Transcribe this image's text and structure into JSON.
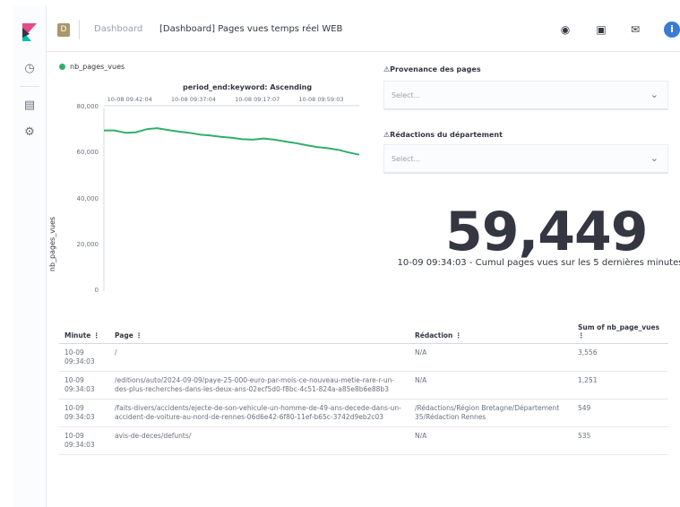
{
  "header": {
    "breadcrumb_root": "Dashboard",
    "breadcrumb_current": "[Dashboard] Pages vues temps réel WEB",
    "logo_glyph": "D"
  },
  "nav": {
    "icons": [
      "clock-icon",
      "dashboard-icon",
      "gear-icon"
    ]
  },
  "chart": {
    "legend": "nb_pages_vues",
    "title": "period_end:keyword: Ascending",
    "y_axis_title": "nb_pages_vues"
  },
  "chart_data": {
    "type": "line",
    "title": "period_end:keyword: Ascending",
    "ylabel": "nb_pages_vues",
    "xlabel": "",
    "ylim": [
      0,
      80000
    ],
    "y_ticks": [
      0,
      20000,
      40000,
      60000,
      80000
    ],
    "y_tick_labels": [
      "0",
      "20,000",
      "40,000",
      "60,000",
      "80,000"
    ],
    "x_tick_labels": [
      "10-08 09:42:04",
      "10-08 09:37:04",
      "10-08 09:17:07",
      "10-08 09:59:03"
    ],
    "series": [
      {
        "name": "nb_pages_vues",
        "color": "#2fb06a",
        "values": [
          70000,
          70000,
          69000,
          69200,
          70500,
          71000,
          70200,
          69500,
          69000,
          68200,
          67800,
          67200,
          66800,
          66200,
          66000,
          66500,
          66000,
          65200,
          64500,
          63600,
          62800,
          62300,
          61600,
          60400,
          59449
        ]
      }
    ],
    "grid": false
  },
  "controls": {
    "provenance_label": "Provenance des pages",
    "provenance_placeholder": "Select...",
    "redaction_label": "Rédactions du département",
    "redaction_placeholder": "Select..."
  },
  "metric": {
    "value": "59,449",
    "label": "10-09 09:34:03 - Cumul pages vues sur les 5 dernières minutes"
  },
  "table": {
    "headers": {
      "minute": "Minute",
      "page": "Page",
      "redaction": "Rédaction",
      "sum": "Sum of nb_page_vues"
    },
    "rows": [
      {
        "minute": "10-09 09:34:03",
        "page": "/",
        "redaction": "N/A",
        "sum": "3,556"
      },
      {
        "minute": "10-09 09:34:03",
        "page": "/editions/auto/2024-09-09/paye-25-000-euro-par-mois-ce-nouveau-metie-rare-r-un-des-plus-recherches-dans-les-deux-ans-02ecf5d0-f8bc-4c51-824a-a85e8b6e88b3",
        "redaction": "N/A",
        "sum": "1,251"
      },
      {
        "minute": "10-09 09:34:03",
        "page": "/faits-divers/accidents/ejecte-de-son-vehicule-un-homme-de-49-ans-decede-dans-un-accident-de-voiture-au-nord-de-rennes-06d6e42-6f80-11ef-b65c-3742d9eb2c03",
        "redaction": "/Rédactions/Région Bretagne/Département 35/Rédaction Rennes",
        "sum": "549"
      },
      {
        "minute": "10-09 09:34:03",
        "page": "avis-de-deces/defunts/",
        "redaction": "N/A",
        "sum": "535"
      }
    ]
  }
}
